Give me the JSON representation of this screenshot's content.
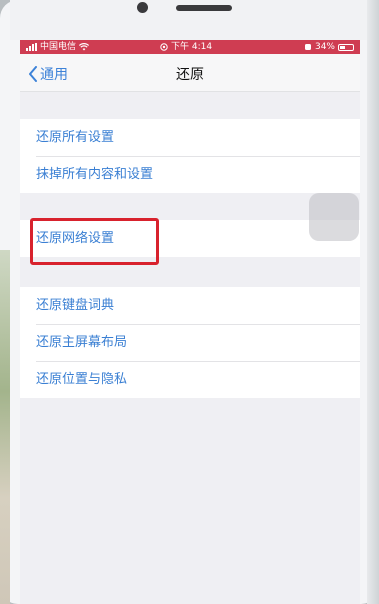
{
  "status_bar": {
    "carrier": "中国电信",
    "time": "下午 4:14",
    "battery": "34%",
    "background_color": "#cf3d52"
  },
  "nav": {
    "back_label": "通用",
    "title": "还原"
  },
  "groups": [
    {
      "items": [
        "还原所有设置",
        "抹掉所有内容和设置"
      ]
    },
    {
      "items": [
        "还原网络设置"
      ]
    },
    {
      "items": [
        "还原键盘词典",
        "还原主屏幕布局",
        "还原位置与隐私"
      ]
    }
  ],
  "accent_color": "#3a7fd3",
  "highlighted_item": "还原网络设置"
}
